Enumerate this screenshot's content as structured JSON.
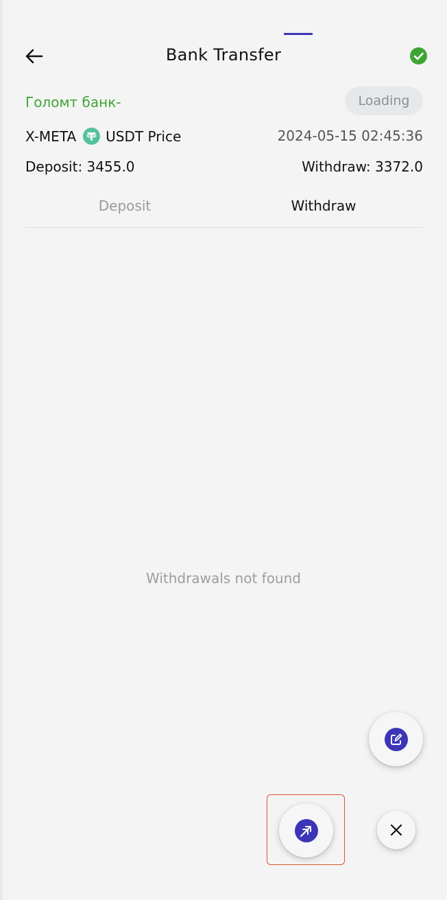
{
  "header": {
    "title": "Bank Transfer",
    "back_icon": "arrow-left-icon",
    "status_icon": "check-circle-icon"
  },
  "bank": {
    "name": "Голомт банк-",
    "status_label": "Loading"
  },
  "price": {
    "asset": "X-META",
    "currency_icon": "tether-icon",
    "label": "USDT Price",
    "timestamp": "2024-05-15 02:45:36"
  },
  "rates": {
    "deposit": "Deposit: 3455.0",
    "withdraw": "Withdraw: 3372.0"
  },
  "tabs": [
    {
      "label": "Deposit",
      "active": false
    },
    {
      "label": "Withdraw",
      "active": true
    }
  ],
  "empty_state": "Withdrawals not found",
  "actions": {
    "edit_icon": "edit-icon",
    "withdraw_icon": "arrow-up-right-icon",
    "close_icon": "close-icon"
  },
  "colors": {
    "accent": "#3c35b8",
    "success": "#3ea535",
    "highlight": "#d9532f",
    "tether": "#53c19b"
  }
}
